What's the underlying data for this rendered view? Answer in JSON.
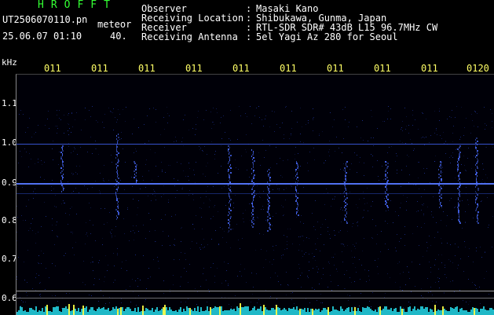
{
  "header": {
    "brand": "HROFFT",
    "filename": "UT2506070110.pn",
    "meteor_label": "meteor",
    "datetime": "25.06.07 01:10",
    "count": "40.",
    "meta": [
      {
        "label": "Observer",
        "value": "Masaki Kano"
      },
      {
        "label": "Receiving Location",
        "value": "Shibukawa, Gunma, Japan"
      },
      {
        "label": "Receiver",
        "value": "RTL-SDR SDR# 43dB L15 96.7MHz CW"
      },
      {
        "label": "Receiving Antenna",
        "value": "5el Yagi Az 280 for Seoul"
      }
    ],
    "separator": ":"
  },
  "axes": {
    "y_unit": "kHz",
    "y_ticks": [
      "1.1",
      "1.0",
      "0.9",
      "0.8",
      "0.7",
      "0.6"
    ],
    "x_ticks": [
      "011",
      "011",
      "011",
      "011",
      "011",
      "011",
      "011",
      "011",
      "011",
      "0120"
    ]
  },
  "colors": {
    "brand": "#33ff33",
    "time_ticks": "#ffff66",
    "signal": "#3355ff",
    "baseline_cyan": "#22ccdd",
    "baseline_yellow": "#ffff44"
  }
}
